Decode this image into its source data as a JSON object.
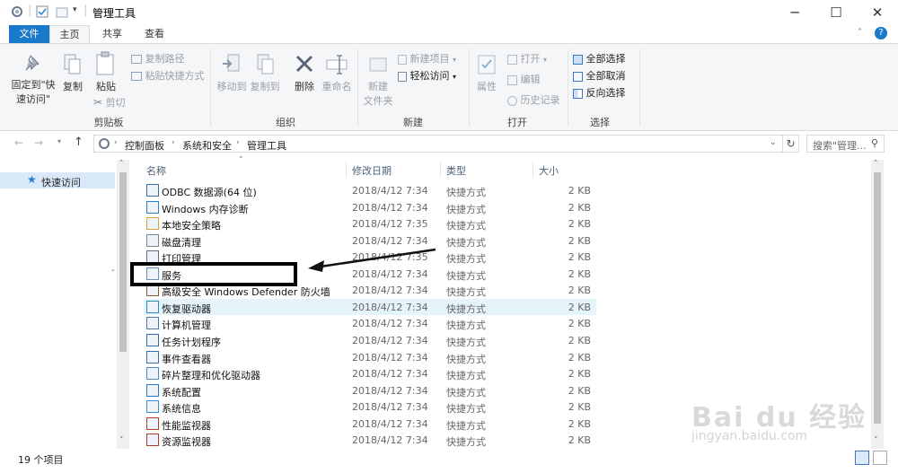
{
  "title": "管理工具",
  "tabs": {
    "file": "文件",
    "home": "主页",
    "share": "共享",
    "view": "查看"
  },
  "ribbon": {
    "pin_line1": "固定到\"快",
    "pin_line2": "速访问\"",
    "copy": "复制",
    "paste": "粘贴",
    "copy_path": "复制路径",
    "paste_shortcut": "粘贴快捷方式",
    "cut": "剪切",
    "group_clipboard": "剪贴板",
    "move_to": "移动到",
    "copy_to": "复制到",
    "delete": "删除",
    "rename": "重命名",
    "group_organize": "组织",
    "new_folder_line1": "新建",
    "new_folder_line2": "文件夹",
    "new_item": "新建项目",
    "easy_access": "轻松访问",
    "group_new": "新建",
    "properties": "属性",
    "open": "打开",
    "edit": "编辑",
    "history": "历史记录",
    "group_open": "打开",
    "select_all": "全部选择",
    "select_none": "全部取消",
    "invert": "反向选择",
    "group_select": "选择"
  },
  "address": {
    "crumbs": [
      "控制面板",
      "系统和安全",
      "管理工具"
    ],
    "search_placeholder": "搜索\"管理..."
  },
  "nav": {
    "quick_access": "快速访问"
  },
  "columns": {
    "name": "名称",
    "date": "修改日期",
    "type": "类型",
    "size": "大小"
  },
  "files": [
    {
      "name": "ODBC 数据源(64 位)",
      "date": "2018/4/12 7:34",
      "type": "快捷方式",
      "size": "2 KB"
    },
    {
      "name": "Windows 内存诊断",
      "date": "2018/4/12 7:34",
      "type": "快捷方式",
      "size": "2 KB"
    },
    {
      "name": "本地安全策略",
      "date": "2018/4/12 7:35",
      "type": "快捷方式",
      "size": "2 KB"
    },
    {
      "name": "磁盘清理",
      "date": "2018/4/12 7:34",
      "type": "快捷方式",
      "size": "2 KB"
    },
    {
      "name": "打印管理",
      "date": "2018/4/12 7:35",
      "type": "快捷方式",
      "size": "2 KB"
    },
    {
      "name": "服务",
      "date": "2018/4/12 7:34",
      "type": "快捷方式",
      "size": "2 KB"
    },
    {
      "name": "高级安全 Windows Defender 防火墙",
      "date": "2018/4/12 7:34",
      "type": "快捷方式",
      "size": "2 KB"
    },
    {
      "name": "恢复驱动器",
      "date": "2018/4/12 7:34",
      "type": "快捷方式",
      "size": "2 KB"
    },
    {
      "name": "计算机管理",
      "date": "2018/4/12 7:34",
      "type": "快捷方式",
      "size": "2 KB"
    },
    {
      "name": "任务计划程序",
      "date": "2018/4/12 7:34",
      "type": "快捷方式",
      "size": "2 KB"
    },
    {
      "name": "事件查看器",
      "date": "2018/4/12 7:34",
      "type": "快捷方式",
      "size": "2 KB"
    },
    {
      "name": "碎片整理和优化驱动器",
      "date": "2018/4/12 7:34",
      "type": "快捷方式",
      "size": "2 KB"
    },
    {
      "name": "系统配置",
      "date": "2018/4/12 7:34",
      "type": "快捷方式",
      "size": "2 KB"
    },
    {
      "name": "系统信息",
      "date": "2018/4/12 7:34",
      "type": "快捷方式",
      "size": "2 KB"
    },
    {
      "name": "性能监视器",
      "date": "2018/4/12 7:34",
      "type": "快捷方式",
      "size": "2 KB"
    },
    {
      "name": "资源监视器",
      "date": "2018/4/12 7:34",
      "type": "快捷方式",
      "size": "2 KB"
    }
  ],
  "status": {
    "count": "19 个项目"
  },
  "watermark": {
    "brand": "Bai du 经验",
    "url": "jingyan.baidu.com"
  },
  "colors": {
    "accent": "#1979ca",
    "highlight": "#d9e9f9",
    "hover_row": "#e5f3fb"
  }
}
